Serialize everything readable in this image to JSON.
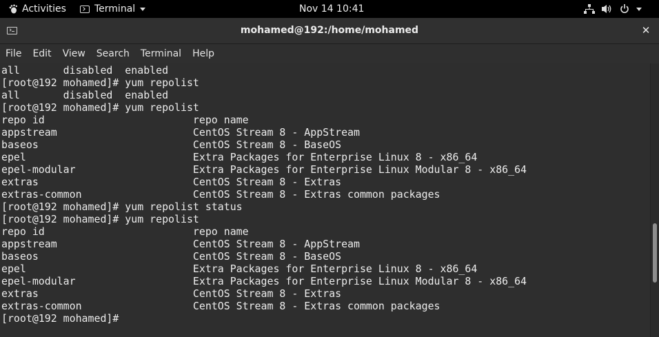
{
  "topbar": {
    "activities_label": "Activities",
    "app_name": "Terminal",
    "clock": "Nov 14  10:41",
    "icons": [
      "network-icon",
      "volume-icon",
      "power-icon",
      "chevron-down-icon"
    ]
  },
  "window": {
    "title": "mohamed@192:/home/mohamed",
    "close_symbol": "✕"
  },
  "menu": [
    "File",
    "Edit",
    "View",
    "Search",
    "Terminal",
    "Help"
  ],
  "terminal": {
    "lines": [
      "all       disabled  enabled",
      "[root@192 mohamed]# yum repolist",
      "all       disabled  enabled",
      "[root@192 mohamed]# yum repolist",
      "repo id                        repo name",
      "appstream                      CentOS Stream 8 - AppStream",
      "baseos                         CentOS Stream 8 - BaseOS",
      "epel                           Extra Packages for Enterprise Linux 8 - x86_64",
      "epel-modular                   Extra Packages for Enterprise Linux Modular 8 - x86_64",
      "extras                         CentOS Stream 8 - Extras",
      "extras-common                  CentOS Stream 8 - Extras common packages",
      "[root@192 mohamed]# yum repolist status",
      "[root@192 mohamed]# yum repolist",
      "repo id                        repo name",
      "appstream                      CentOS Stream 8 - AppStream",
      "baseos                         CentOS Stream 8 - BaseOS",
      "epel                           Extra Packages for Enterprise Linux 8 - x86_64",
      "epel-modular                   Extra Packages for Enterprise Linux Modular 8 - x86_64",
      "extras                         CentOS Stream 8 - Extras",
      "extras-common                  CentOS Stream 8 - Extras common packages",
      "[root@192 mohamed]# "
    ],
    "scroll_position": 0.75,
    "scroll_visible_fraction": 0.22
  },
  "colors": {
    "topbar_bg": "#000000",
    "terminal_bg": "#2e2e2e",
    "terminal_fg": "#ececec"
  }
}
